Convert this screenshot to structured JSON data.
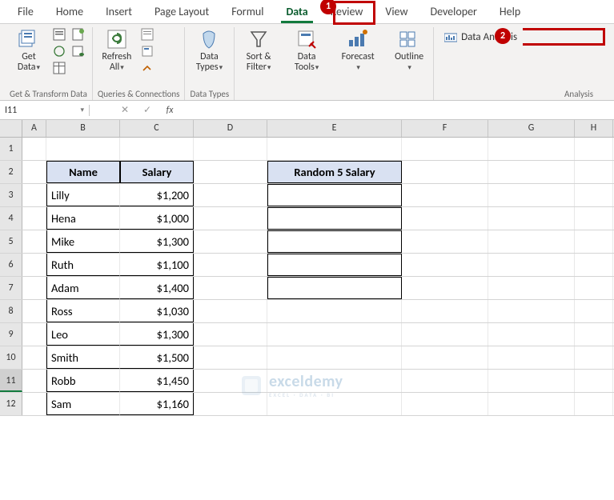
{
  "menu": {
    "items": [
      "File",
      "Home",
      "Insert",
      "Page Layout",
      "Formul",
      "Data",
      "Review",
      "View",
      "Developer",
      "Help"
    ],
    "active_index": 5
  },
  "badges": {
    "one": "1",
    "two": "2"
  },
  "ribbon": {
    "get_data": {
      "label_l1": "Get",
      "label_l2": "Data"
    },
    "group1_label": "Get & Transform Data",
    "refresh": {
      "label_l1": "Refresh",
      "label_l2": "All"
    },
    "group2_label": "Queries & Connections",
    "data_types": {
      "label_l1": "Data",
      "label_l2": "Types"
    },
    "group3_label": "Data Types",
    "sort_filter": {
      "label_l1": "Sort &",
      "label_l2": "Filter"
    },
    "data_tools": {
      "label_l1": "Data",
      "label_l2": "Tools"
    },
    "forecast": {
      "label_l1": "Forecast",
      "label_l2": ""
    },
    "outline": {
      "label_l1": "Outline",
      "label_l2": ""
    },
    "data_analysis": "Data Analysis",
    "analysis_label": "Analysis"
  },
  "namebox": "I11",
  "columns": [
    "A",
    "B",
    "C",
    "D",
    "E",
    "F",
    "G",
    "H"
  ],
  "row_numbers": [
    "1",
    "2",
    "3",
    "4",
    "5",
    "6",
    "7",
    "8",
    "9",
    "10",
    "11",
    "12"
  ],
  "selected_row": 11,
  "data": {
    "table1": {
      "headers": [
        "Name",
        "Salary"
      ],
      "rows": [
        [
          "Lilly",
          "$1,200"
        ],
        [
          "Hena",
          "$1,000"
        ],
        [
          "Mike",
          "$1,300"
        ],
        [
          "Ruth",
          "$1,100"
        ],
        [
          "Adam",
          "$1,400"
        ],
        [
          "Ross",
          "$1,030"
        ],
        [
          "Leo",
          "$1,300"
        ],
        [
          "Smith",
          "$1,500"
        ],
        [
          "Robb",
          "$1,450"
        ],
        [
          "Sam",
          "$1,160"
        ]
      ]
    },
    "table2": {
      "header": "Random 5 Salary",
      "row_count": 5
    }
  },
  "watermark": {
    "brand": "exceldemy",
    "sub": "EXCEL · DATA · BI"
  }
}
